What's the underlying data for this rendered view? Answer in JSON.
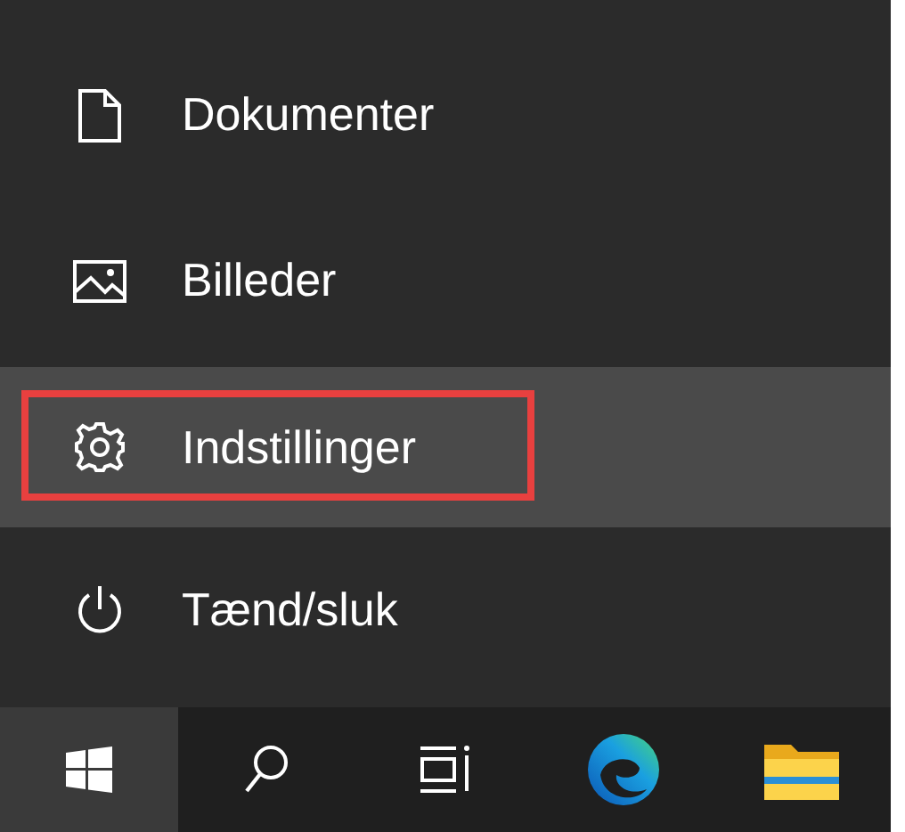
{
  "menu": {
    "items": [
      {
        "kind": "document",
        "label": "Dokumenter",
        "selected": false,
        "highlighted": false
      },
      {
        "kind": "picture",
        "label": "Billeder",
        "selected": false,
        "highlighted": false
      },
      {
        "kind": "settings",
        "label": "Indstillinger",
        "selected": true,
        "highlighted": true
      },
      {
        "kind": "power",
        "label": "Tænd/sluk",
        "selected": false,
        "highlighted": false
      }
    ]
  },
  "taskbar": {
    "items": [
      {
        "kind": "start",
        "selected": true
      },
      {
        "kind": "search",
        "selected": false
      },
      {
        "kind": "taskview",
        "selected": false
      },
      {
        "kind": "browser",
        "selected": false
      },
      {
        "kind": "files",
        "selected": false
      }
    ]
  }
}
